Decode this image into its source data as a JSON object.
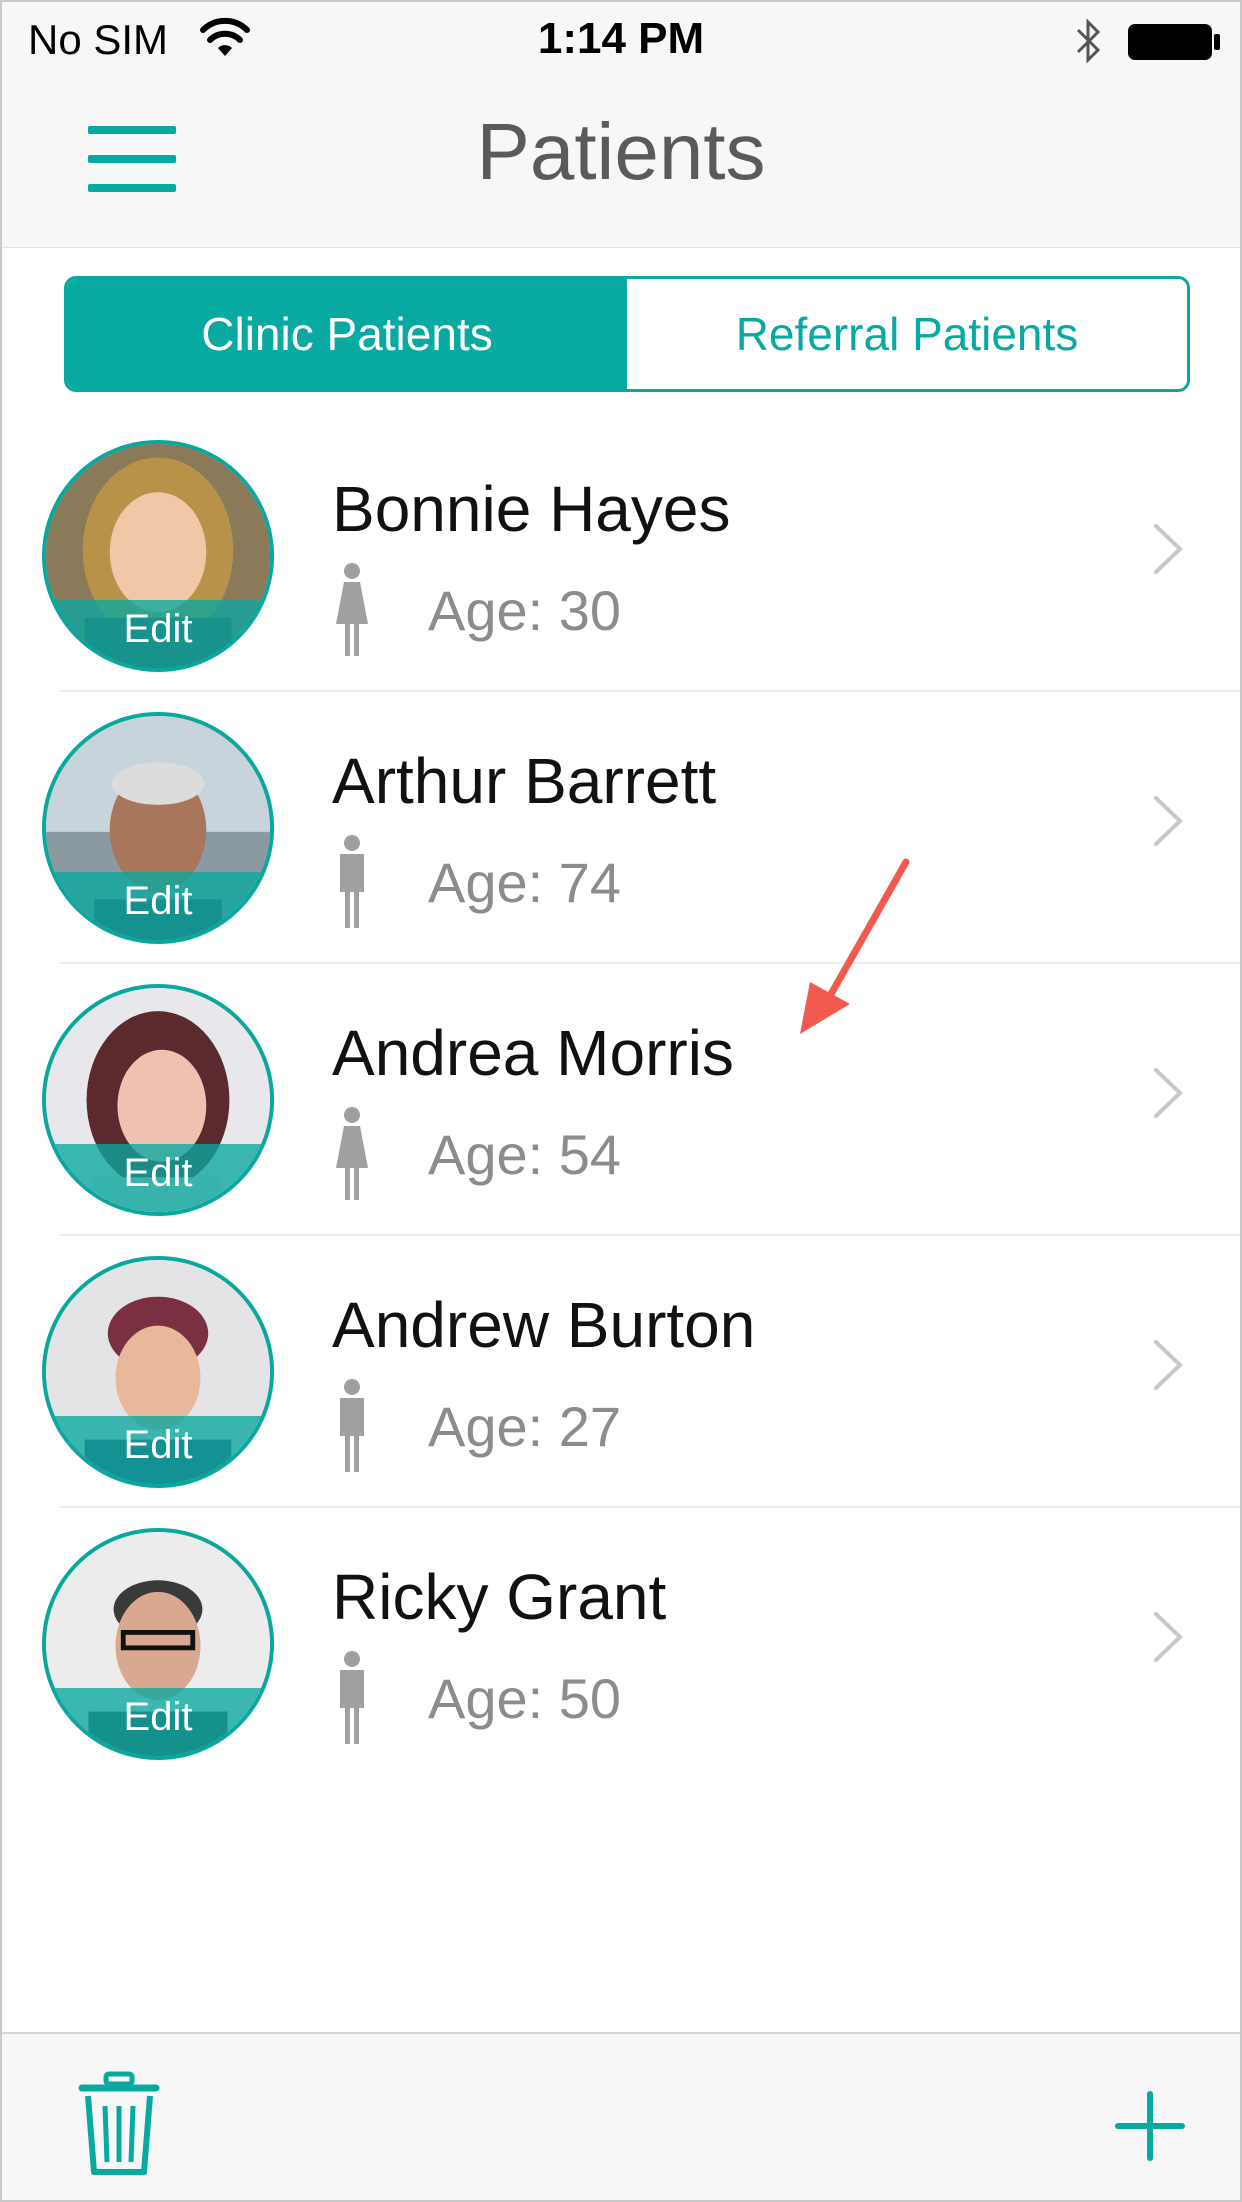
{
  "status_bar": {
    "carrier": "No SIM",
    "time": "1:14 PM",
    "icons": [
      "wifi-icon",
      "bluetooth-icon",
      "battery-icon"
    ]
  },
  "nav": {
    "title": "Patients",
    "menu_icon": "hamburger-menu-icon"
  },
  "segments": {
    "clinic": "Clinic Patients",
    "referral": "Referral Patients",
    "selected": "clinic"
  },
  "patients": [
    {
      "name": "Bonnie Hayes",
      "age": "Age: 30",
      "gender": "female",
      "edit": "Edit"
    },
    {
      "name": "Arthur Barrett",
      "age": "Age: 74",
      "gender": "male",
      "edit": "Edit"
    },
    {
      "name": "Andrea Morris",
      "age": "Age: 54",
      "gender": "female",
      "edit": "Edit"
    },
    {
      "name": "Andrew Burton",
      "age": "Age: 27",
      "gender": "male",
      "edit": "Edit"
    },
    {
      "name": "Ricky Grant",
      "age": "Age: 50",
      "gender": "male",
      "edit": "Edit"
    }
  ],
  "toolbar": {
    "left_icon": "trash-icon",
    "right_icon": "add-icon"
  },
  "colors": {
    "accent": "#08a9a0",
    "annotation": "#f05a4f",
    "secondary_text": "#8c8c8c",
    "gender_icon": "#a0a0a0"
  }
}
